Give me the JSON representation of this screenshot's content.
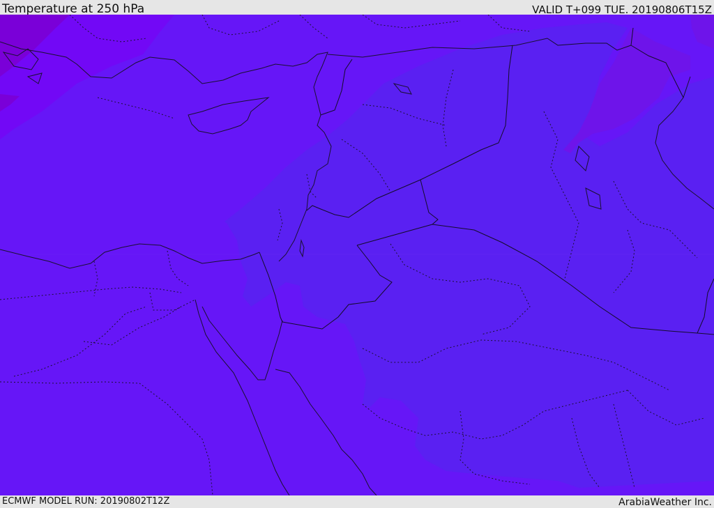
{
  "header": {
    "title": "Temperature at 250 hPa",
    "valid": "VALID T+099 TUE. 20190806T15Z"
  },
  "footer": {
    "model_run": "ECMWF MODEL RUN: 20190802T12Z",
    "credit": "ArabiaWeather Inc."
  },
  "colors": {
    "bar_background": "#e6e6e6",
    "field_main": "#6616f7",
    "field_cool": "#5a20f2",
    "field_warm_band": "#7208f6",
    "field_warmest": "#7a00d8",
    "field_cold_spot": "#6e14ea",
    "coastline": "#1a1030",
    "border": "#140c2a"
  }
}
